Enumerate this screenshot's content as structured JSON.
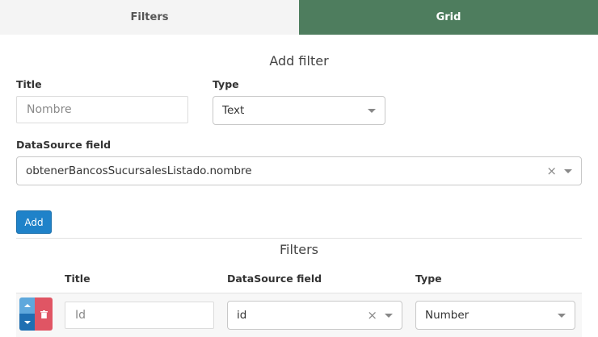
{
  "tabs": [
    {
      "label": "Filters"
    },
    {
      "label": "Grid"
    }
  ],
  "add_filter": {
    "heading": "Add filter",
    "title_label": "Title",
    "title_placeholder": "Nombre",
    "type_label": "Type",
    "type_value": "Text",
    "datasource_label": "DataSource field",
    "datasource_value": "obtenerBancosSucursalesListado.nombre",
    "add_button": "Add"
  },
  "filters_table": {
    "heading": "Filters",
    "columns": [
      "Title",
      "DataSource field",
      "Type"
    ],
    "rows": [
      {
        "title_placeholder": "Id",
        "datasource": "id",
        "type": "Number"
      }
    ]
  },
  "colors": {
    "active_tab": "#4e7d5e",
    "primary_button": "#1f82c9",
    "delete_button": "#e05564"
  },
  "icons": [
    "chevron-down-icon",
    "clear-icon",
    "arrow-up-icon",
    "arrow-down-icon",
    "trash-icon"
  ]
}
